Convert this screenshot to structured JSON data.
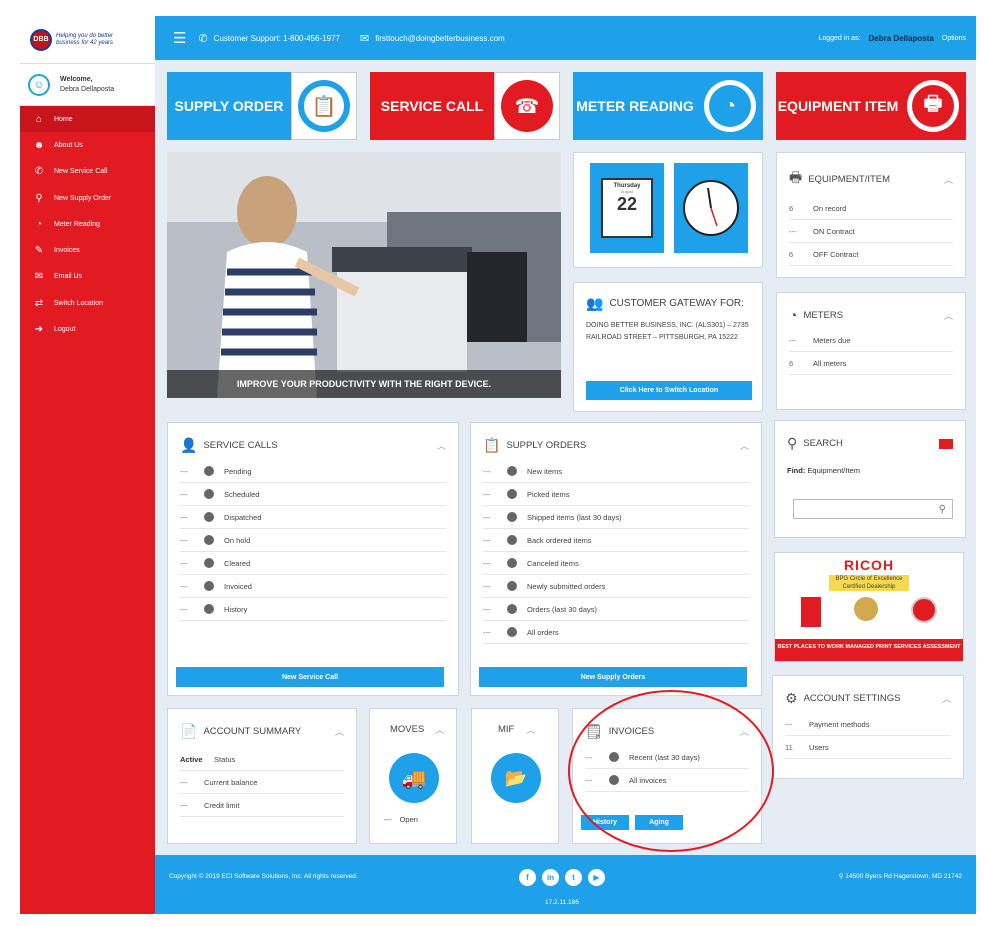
{
  "brand": {
    "logo_badge": "DBB",
    "logo_tagline": "Helping you do better business for 42 years"
  },
  "welcome": {
    "label": "Welcome,",
    "user": "Debra Dellaposta"
  },
  "sidebar": {
    "items": [
      {
        "label": "Home",
        "icon": "home-icon",
        "glyph": "⌂",
        "active": true
      },
      {
        "label": "About Us",
        "icon": "user-icon",
        "glyph": "☻"
      },
      {
        "label": "New Service Call",
        "icon": "phone-icon",
        "glyph": "✆"
      },
      {
        "label": "New Supply Order",
        "icon": "supply-icon",
        "glyph": "⚲"
      },
      {
        "label": "Meter Reading",
        "icon": "gauge-icon",
        "glyph": "◔"
      },
      {
        "label": "Invoices",
        "icon": "handshake-icon",
        "glyph": "✎"
      },
      {
        "label": "Email Us",
        "icon": "envelope-icon",
        "glyph": "✉"
      },
      {
        "label": "Switch Location",
        "icon": "location-icon",
        "glyph": "⇄"
      },
      {
        "label": "Logout",
        "icon": "logout-icon",
        "glyph": "➜"
      }
    ]
  },
  "topbar": {
    "support": "Customer Support: 1-800-456-1977",
    "email": "firsttouch@doingbetterbusiness.com",
    "logged_in_label": "Logged in as:",
    "user": "Debra Dellaposta",
    "options": "Options"
  },
  "tiles": {
    "supply_order": "SUPPLY ORDER",
    "service_call": "SERVICE CALL",
    "meter_reading": "METER READING",
    "equipment_item": "EQUIPMENT ITEM"
  },
  "hero": {
    "caption": "IMPROVE YOUR PRODUCTIVITY WITH THE RIGHT DEVICE."
  },
  "calendar": {
    "weekday": "Thursday",
    "month": "August",
    "day": "22"
  },
  "gateway": {
    "title": "CUSTOMER GATEWAY FOR:",
    "address": "DOING BETTER BUSINESS, INC. (ALS301) – 2735 RAILROAD STREET – PITTSBURGH, PA 15222",
    "button": "Click Here to Switch Location"
  },
  "equipment": {
    "title": "EQUIPMENT/ITEM",
    "rows": [
      {
        "count": "6",
        "label": "On record"
      },
      {
        "count": "---",
        "label": "ON Contract"
      },
      {
        "count": "6",
        "label": "OFF Contract"
      }
    ]
  },
  "meters": {
    "title": "METERS",
    "rows": [
      {
        "count": "---",
        "label": "Meters due"
      },
      {
        "count": "6",
        "label": "All meters"
      }
    ]
  },
  "service_calls": {
    "title": "SERVICE CALLS",
    "rows": [
      {
        "count": "---",
        "label": "Pending"
      },
      {
        "count": "---",
        "label": "Scheduled"
      },
      {
        "count": "---",
        "label": "Dispatched"
      },
      {
        "count": "---",
        "label": "On hold"
      },
      {
        "count": "---",
        "label": "Cleared"
      },
      {
        "count": "---",
        "label": "Invoiced"
      },
      {
        "count": "---",
        "label": "History"
      }
    ],
    "button": "New Service Call"
  },
  "supply_orders": {
    "title": "SUPPLY ORDERS",
    "rows": [
      {
        "count": "---",
        "label": "New items"
      },
      {
        "count": "---",
        "label": "Picked items"
      },
      {
        "count": "---",
        "label": "Shipped items (last 30 days)"
      },
      {
        "count": "---",
        "label": "Back ordered items"
      },
      {
        "count": "---",
        "label": "Canceled items"
      },
      {
        "count": "---",
        "label": "Newly submitted orders"
      },
      {
        "count": "---",
        "label": "Orders (last 30 days)"
      },
      {
        "count": "---",
        "label": "All orders"
      }
    ],
    "button": "New Supply Orders"
  },
  "search": {
    "title": "SEARCH",
    "find_label": "Find:",
    "find_value": "Equipment/Item"
  },
  "ricoh": {
    "brand": "RICOH",
    "subtitle": "BPG Circle of Excellence Certified Dealership",
    "footer": "BEST PLACES TO WORK MANAGED PRINT SERVICES ASSESSMENT"
  },
  "account_settings": {
    "title": "ACCOUNT SETTINGS",
    "rows": [
      {
        "count": "---",
        "label": "Payment methods"
      },
      {
        "count": "11",
        "label": "Users"
      }
    ]
  },
  "account_summary": {
    "title": "ACCOUNT SUMMARY",
    "status_key": "Active",
    "status_label": "Status",
    "rows": [
      {
        "count": "---",
        "label": "Current balance"
      },
      {
        "count": "---",
        "label": "Credit limit"
      }
    ]
  },
  "moves": {
    "title": "MOVES",
    "row_count": "---",
    "row_label": "Open"
  },
  "mif": {
    "title": "MIF"
  },
  "invoices": {
    "title": "INVOICES",
    "rows": [
      {
        "count": "---",
        "label": "Recent (last 30 days)"
      },
      {
        "count": "---",
        "label": "All invoices"
      }
    ],
    "btn_history": "History",
    "btn_aging": "Aging"
  },
  "footer": {
    "copyright": "Copyright © 2019 ECI Software Solutions, Inc. All rights reserved.",
    "version": "17.2.11.186",
    "address": "14500 Byers Rd Hagerstown, MD 21742",
    "social": [
      "f",
      "in",
      "t",
      "▶"
    ]
  },
  "colors": {
    "brand_red": "#e21b23",
    "brand_blue": "#1ea1e8",
    "highlight": "#e21b23"
  }
}
